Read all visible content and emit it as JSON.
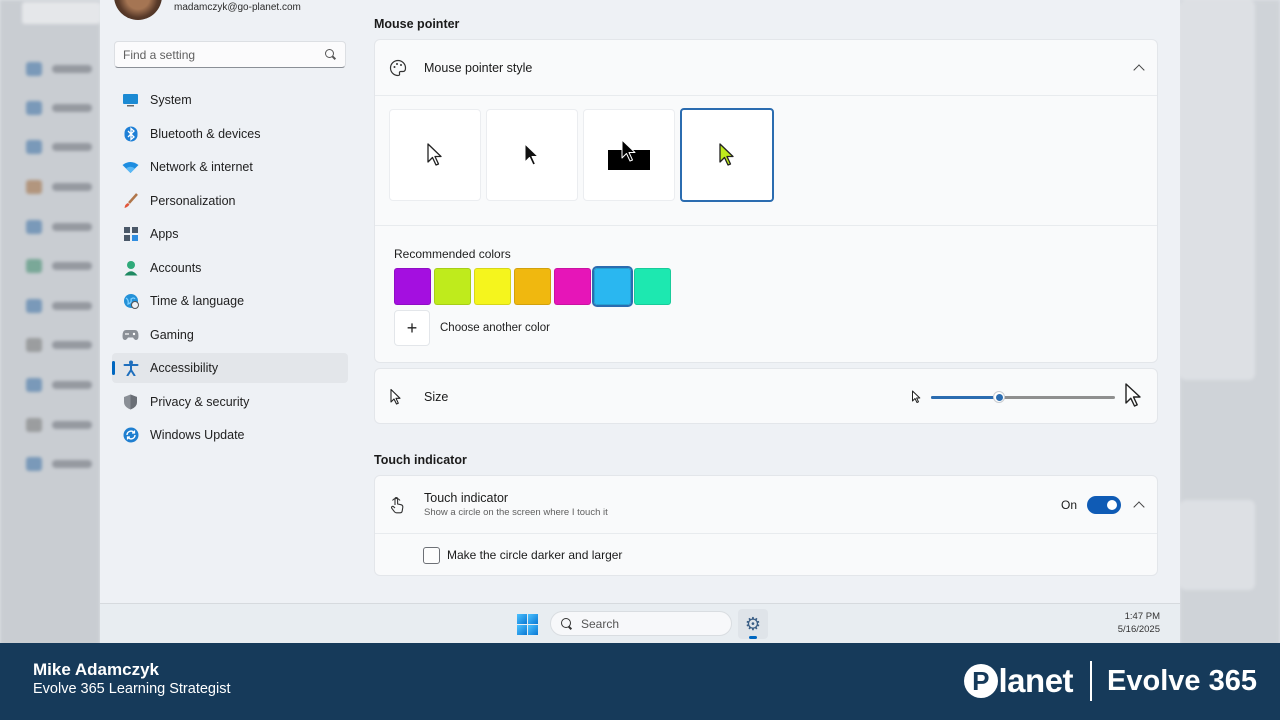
{
  "background_app": {
    "search_placeholder": "Find a setting"
  },
  "user": {
    "email": "madamczyk@go-planet.com"
  },
  "sidebar": {
    "search_placeholder": "Find a setting",
    "items": [
      {
        "label": "System",
        "icon": "monitor-icon",
        "active": false
      },
      {
        "label": "Bluetooth & devices",
        "icon": "bluetooth-icon",
        "active": false
      },
      {
        "label": "Network & internet",
        "icon": "wifi-icon",
        "active": false
      },
      {
        "label": "Personalization",
        "icon": "brush-icon",
        "active": false
      },
      {
        "label": "Apps",
        "icon": "apps-icon",
        "active": false
      },
      {
        "label": "Accounts",
        "icon": "person-icon",
        "active": false
      },
      {
        "label": "Time & language",
        "icon": "globe-clock-icon",
        "active": false
      },
      {
        "label": "Gaming",
        "icon": "gamepad-icon",
        "active": false
      },
      {
        "label": "Accessibility",
        "icon": "accessibility-icon",
        "active": true
      },
      {
        "label": "Privacy & security",
        "icon": "shield-icon",
        "active": false
      },
      {
        "label": "Windows Update",
        "icon": "update-icon",
        "active": false
      }
    ]
  },
  "mouse_pointer": {
    "section_title": "Mouse pointer",
    "style_label": "Mouse pointer style",
    "styles": [
      {
        "name": "white",
        "selected": false
      },
      {
        "name": "black",
        "selected": false
      },
      {
        "name": "inverted",
        "selected": false
      },
      {
        "name": "custom",
        "selected": true
      }
    ],
    "recommended_label": "Recommended colors",
    "colors": [
      "#a40fe0",
      "#bfeb1c",
      "#f5f51d",
      "#f0b80f",
      "#e615b8",
      "#2ab7f0",
      "#1de8b0"
    ],
    "selected_color_index": 5,
    "custom_pointer_color": "#bfeb1c",
    "choose_color_label": "Choose another color",
    "size_label": "Size",
    "size_value_fraction": 0.37
  },
  "touch": {
    "section_title": "Touch indicator",
    "title": "Touch indicator",
    "subtitle": "Show a circle on the screen where I touch it",
    "toggle_label": "On",
    "toggle_on": true,
    "darker_label": "Make the circle darker and larger",
    "darker_checked": false
  },
  "taskbar": {
    "search_label": "Search",
    "time": "1:47 PM",
    "date": "5/16/2025"
  },
  "banner": {
    "name": "Mike Adamczyk",
    "role": "Evolve 365 Learning Strategist",
    "brand_name": "lanet",
    "brand_initial": "P",
    "brand_tagline": "Evolve 365"
  },
  "colors": {
    "accent": "#0067c0",
    "banner": "#163a5a"
  }
}
